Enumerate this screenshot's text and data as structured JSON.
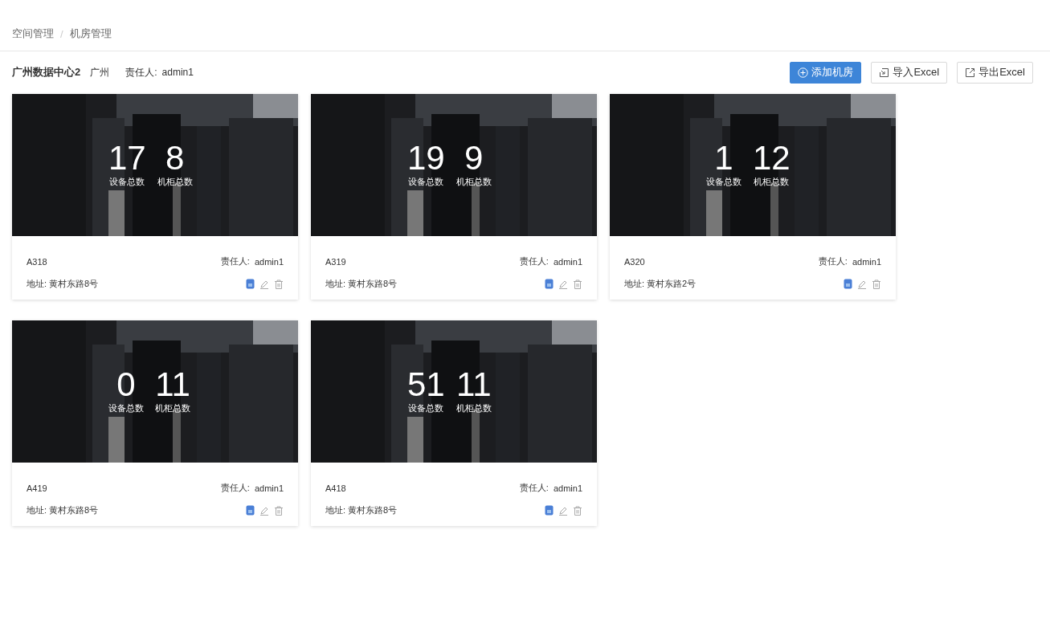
{
  "breadcrumb": [
    "空间管理",
    "机房管理"
  ],
  "breadcrumb_separator": "/",
  "header": {
    "title": "广州数据中心2",
    "city": "广州",
    "owner_label": "责任人:",
    "owner": "admin1"
  },
  "buttons": [
    {
      "label": "添加机房",
      "kind": "primary"
    },
    {
      "label": "导入Excel",
      "kind": "import"
    },
    {
      "label": "导出Excel",
      "kind": "export"
    }
  ],
  "rooms": [
    {
      "name": "A318",
      "devices": "17",
      "devices_label": "设备总数",
      "cabinets": "8",
      "cabinets_label": "机柜总数",
      "owner_label": "责任人:",
      "owner": "admin1",
      "address": "地址: 黄村东路8号"
    },
    {
      "name": "A319",
      "devices": "19",
      "devices_label": "设备总数",
      "cabinets": "9",
      "cabinets_label": "机柜总数",
      "owner_label": "责任人:",
      "owner": "admin1",
      "address": "地址: 黄村东路8号"
    },
    {
      "name": "A320",
      "devices": "1",
      "devices_label": "设备总数",
      "cabinets": "12",
      "cabinets_label": "机柜总数",
      "owner_label": "责任人:",
      "owner": "admin1",
      "address": "地址: 黄村东路2号"
    },
    {
      "name": "A419",
      "devices": "0",
      "devices_label": "设备总数",
      "cabinets": "11",
      "cabinets_label": "机柜总数",
      "owner_label": "责任人:",
      "owner": "admin1",
      "address": "地址: 黄村东路8号"
    },
    {
      "name": "A418",
      "devices": "51",
      "devices_label": "设备总数",
      "cabinets": "11",
      "cabinets_label": "机柜总数",
      "owner_label": "责任人:",
      "owner": "admin1",
      "address": "地址: 黄村东路8号"
    }
  ]
}
